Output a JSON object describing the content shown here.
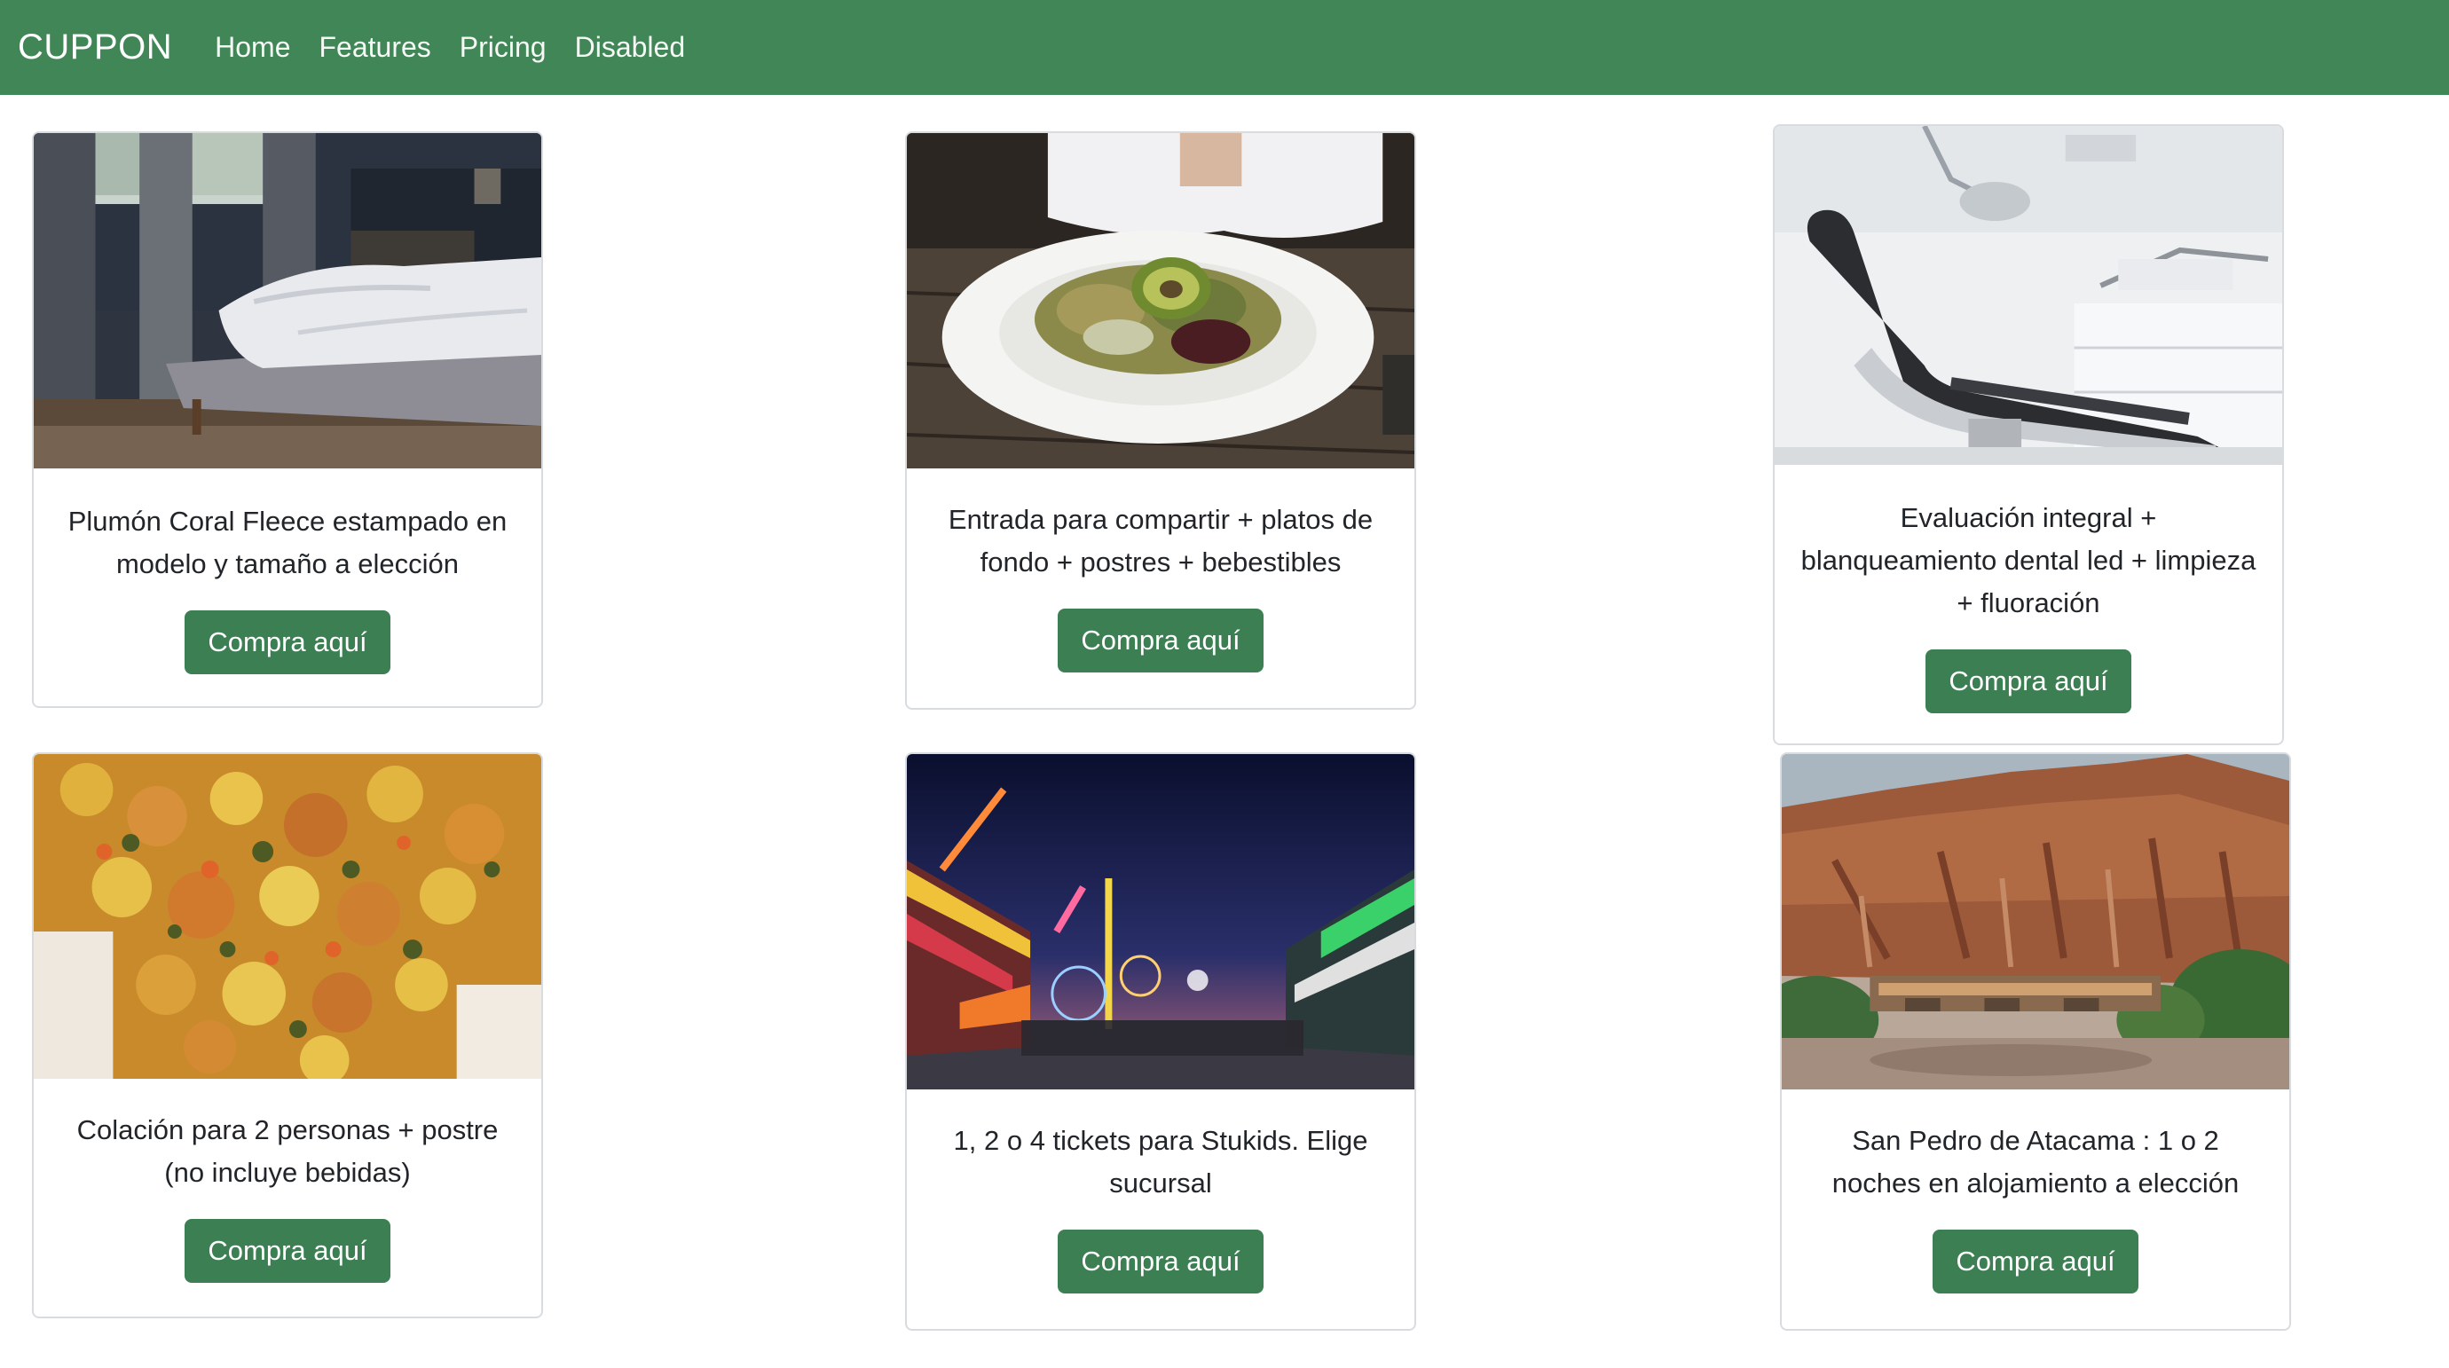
{
  "navbar": {
    "brand": "CUPPON",
    "links": [
      "Home",
      "Features",
      "Pricing",
      "Disabled"
    ]
  },
  "cards": [
    {
      "image": "bedroom-photo",
      "text": "Plumón Coral Fleece estampado en modelo y tamaño a elección",
      "button": "Compra aquí"
    },
    {
      "image": "salad-plate-photo",
      "text": "Entrada para compartir + platos de fondo + postres + bebestibles",
      "button": "Compra aquí"
    },
    {
      "image": "dental-chair-photo",
      "text": "Evaluación integral + blanqueamiento dental led + limpieza + fluoración",
      "button": "Compra aquí"
    },
    {
      "image": "food-dish-photo",
      "text": "Colación para 2 personas + postre (no incluye bebidas)",
      "button": "Compra aquí"
    },
    {
      "image": "fair-night-photo",
      "text": "1, 2 o 4 tickets para Stukids. Elige sucursal",
      "button": "Compra aquí"
    },
    {
      "image": "atacama-canyon-photo",
      "text": "San Pedro de Atacama : 1 o 2 noches en alojamiento a elección",
      "button": "Compra aquí"
    }
  ],
  "colors": {
    "navbar": "#418656",
    "button": "#3b7f53",
    "card_border": "#d9dcdf"
  }
}
